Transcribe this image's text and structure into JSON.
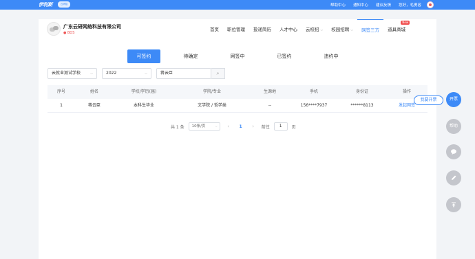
{
  "topbar": {
    "logo": "伊利斯",
    "logo_sub": "云研招",
    "links": [
      "帮助中心",
      "通知中心",
      "建议反馈",
      "您好，毛勇容"
    ]
  },
  "header": {
    "company_name": "广东云研网络科技有限公司",
    "company_tag": "BOS",
    "nav": [
      {
        "label": "首页",
        "caret": false
      },
      {
        "label": "职位管理",
        "caret": false
      },
      {
        "label": "投递简历",
        "caret": false
      },
      {
        "label": "人才中心",
        "caret": false
      },
      {
        "label": "云校招",
        "caret": true
      },
      {
        "label": "校园招聘",
        "caret": true
      },
      {
        "label": "网签三方",
        "caret": false,
        "active": true
      },
      {
        "label": "道具商城",
        "caret": false,
        "badge": "New"
      }
    ]
  },
  "tabs": [
    "可签约",
    "待确定",
    "网签中",
    "已签约",
    "违约中"
  ],
  "filters": {
    "school": "云就业测试学校",
    "year": "2022",
    "search_value": "蒋云臣"
  },
  "table": {
    "headers": [
      "序号",
      "姓名",
      "学校/学历(届)",
      "学院/专业",
      "生源地",
      "手机",
      "身份证",
      "操作"
    ],
    "rows": [
      {
        "index": "1",
        "name": "蒋云臣",
        "school": "本科生毕业",
        "major": "文学院 / 哲学类",
        "origin": "--",
        "phone": "156****7937",
        "id_card": "******8113",
        "action": "发起网签"
      }
    ]
  },
  "pagination": {
    "total": "共 1 条",
    "page_size": "10条/页",
    "current": "1",
    "goto_label": "前往",
    "goto_value": "1",
    "page_suffix": "页"
  },
  "side": {
    "invoice_tip": "我要开票",
    "invoice": "开票",
    "help": "帮助"
  }
}
